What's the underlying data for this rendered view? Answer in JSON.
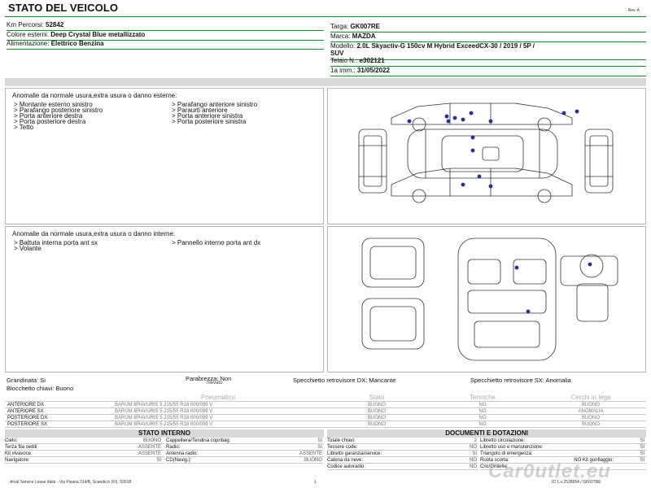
{
  "header": {
    "title": "STATO DEL VEICOLO",
    "rev": "Rev. A"
  },
  "vehicle_left": [
    {
      "label": "Km Percorsi:",
      "value": "52842"
    },
    {
      "label": "Colore esterni:",
      "value": "Deep Crystal Blue metallizzato"
    },
    {
      "label": "Alimentazione:",
      "value": "Elettrico Benzina"
    }
  ],
  "vehicle_right": {
    "targa": {
      "label": "Targa:",
      "value": "GK007RE"
    },
    "marca": {
      "label": "Marca:",
      "value": "MAZDA"
    },
    "modello": {
      "label": "Modello:",
      "value": "2.0L Skyactiv-G 150cv M Hybrid ExceedCX-30 / 2019 / 5P /",
      "value2": "SUV"
    },
    "telaio": {
      "label": "Telaio N.:",
      "value": "e302121"
    },
    "imm": {
      "label": "1a imm.:",
      "value": "31/05/2022"
    }
  },
  "external_damage": {
    "title": "Anomalie da normale usura,extra usura o danno esterne:",
    "left": [
      "> Montante esterno sinistro",
      "> Parafango posteriore sinistro",
      "> Porta anteriore destra",
      "> Porta posteriore destra",
      "> Tetto"
    ],
    "right": [
      "> Parafango anteriore sinistro",
      "> Paraurti anteriore",
      "> Porta anteriore sinistra",
      "> Porta posteriore sinistra"
    ]
  },
  "internal_damage": {
    "title": "Anomalie da normale usura,extra usura o danno interne:",
    "left": [
      "> Battuta interna porta ant sx",
      "> Volante"
    ],
    "right": [
      "> Pannello interno porta ant dx"
    ]
  },
  "summary": {
    "grandinata": "Grandinata: Si",
    "parabrezza": "Parabrezza: Non",
    "parabrezza_sub": "rilevato",
    "specchietto_dx": "Specchietto retrovisore DX: Mancante",
    "specchietto_sx": "Specchietto retrovisore SX: Anomalia",
    "blocchetto": "Blocchetto chiavi: Buono"
  },
  "tyres": {
    "headers": [
      "Pneumatico",
      "Stato",
      "Tenniche",
      "Cerchi in lega"
    ],
    "rows": [
      {
        "pos": "ANTERIORE DX",
        "model": "BARUM BRAVURIS 5 215/55 R18 000/099 V",
        "stato": "BUONO",
        "tec": "NO",
        "cerchi": "BUONO"
      },
      {
        "pos": "ANTERIORE SX",
        "model": "BARUM BRAVURIS 5 215/55 R18 000/099 V",
        "stato": "BUONO",
        "tec": "NO",
        "cerchi": "ANOMALIA"
      },
      {
        "pos": "POSTERIORE DX",
        "model": "BARUM BRAVURIS 5 215/55 R18 000/099 V",
        "stato": "BUONO",
        "tec": "NO",
        "cerchi": "BUONO"
      },
      {
        "pos": "POSTERIORE SX",
        "model": "BARUM BRAVURIS 5 215/55 R18 000/099 V",
        "stato": "BUONO",
        "tec": "NO",
        "cerchi": "BUONO"
      }
    ]
  },
  "interno": {
    "title": "STATO INTERNO",
    "left": [
      {
        "k": "Cielo:",
        "v": "BUONO"
      },
      {
        "k": "Terza fila sedili:",
        "v": "ASSENTE"
      },
      {
        "k": "Kit vivavoce:",
        "v": "ASSENTE"
      },
      {
        "k": "Navigatore:",
        "v": "SI"
      }
    ],
    "right": [
      {
        "k": "Cappelliera/Tendina copribag:",
        "v": "SI"
      },
      {
        "k": "Radio:",
        "v": "SI"
      },
      {
        "k": "Antenna radio:",
        "v": "ASSENTE"
      },
      {
        "k": "CD(Navig.):",
        "v": "BUONO"
      }
    ]
  },
  "documenti": {
    "title": "DOCUMENTI E DOTAZIONI",
    "left": [
      {
        "k": "Totale chiavi:",
        "v": "2"
      },
      {
        "k": "Tessere code:",
        "v": "NO"
      },
      {
        "k": "Libretto garanzia/service:",
        "v": "SI"
      },
      {
        "k": "Catena da neve:",
        "v": "NO"
      },
      {
        "k": "Codice autoradio:",
        "v": "NO"
      }
    ],
    "right": [
      {
        "k": "Libretto circolazione:",
        "v": "SI"
      },
      {
        "k": "Libretto uso e manutenzione:",
        "v": "SI"
      },
      {
        "k": "Triangolo di emergenza:",
        "v": "SI"
      },
      {
        "k": "Ruota scorta:",
        "v": "NO Kit gonfiaggio:",
        "v2": "SI"
      },
      {
        "k": "Cric/Giravite:",
        "v": ""
      }
    ]
  },
  "footer": {
    "company": "Arval Service Lease Italia - Via Pisana 314/B, Scandicci (FI), 50018",
    "page": "1",
    "doc": "ID 1.x.2528654 / GK007RE",
    "watermark": "Car0utlet.eu"
  },
  "colors": {
    "accent_line": "#1b8a2b",
    "band": "#d9d9d9",
    "damage_dot": "#1f2fa8"
  }
}
